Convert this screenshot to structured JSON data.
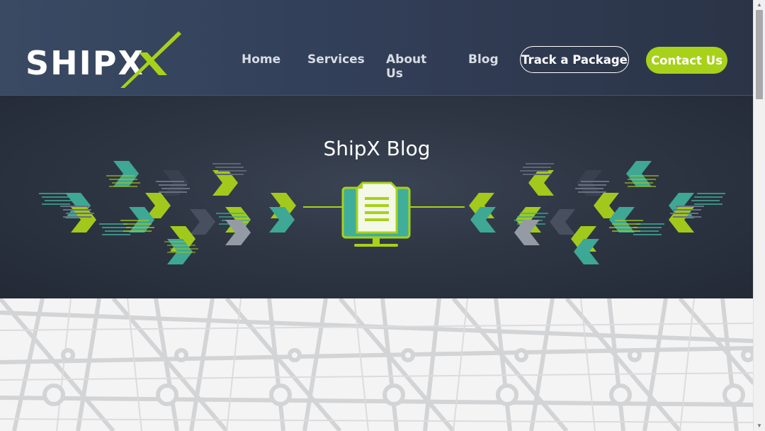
{
  "brand": {
    "name": "SHIPX",
    "accent_color": "#a8d11a"
  },
  "nav": {
    "home": "Home",
    "services": "Services",
    "about": "About Us",
    "blog": "Blog",
    "track": "Track a Package",
    "contact": "Contact Us"
  },
  "hero": {
    "title": "ShipX Blog",
    "icon": "document-monitor-icon"
  }
}
